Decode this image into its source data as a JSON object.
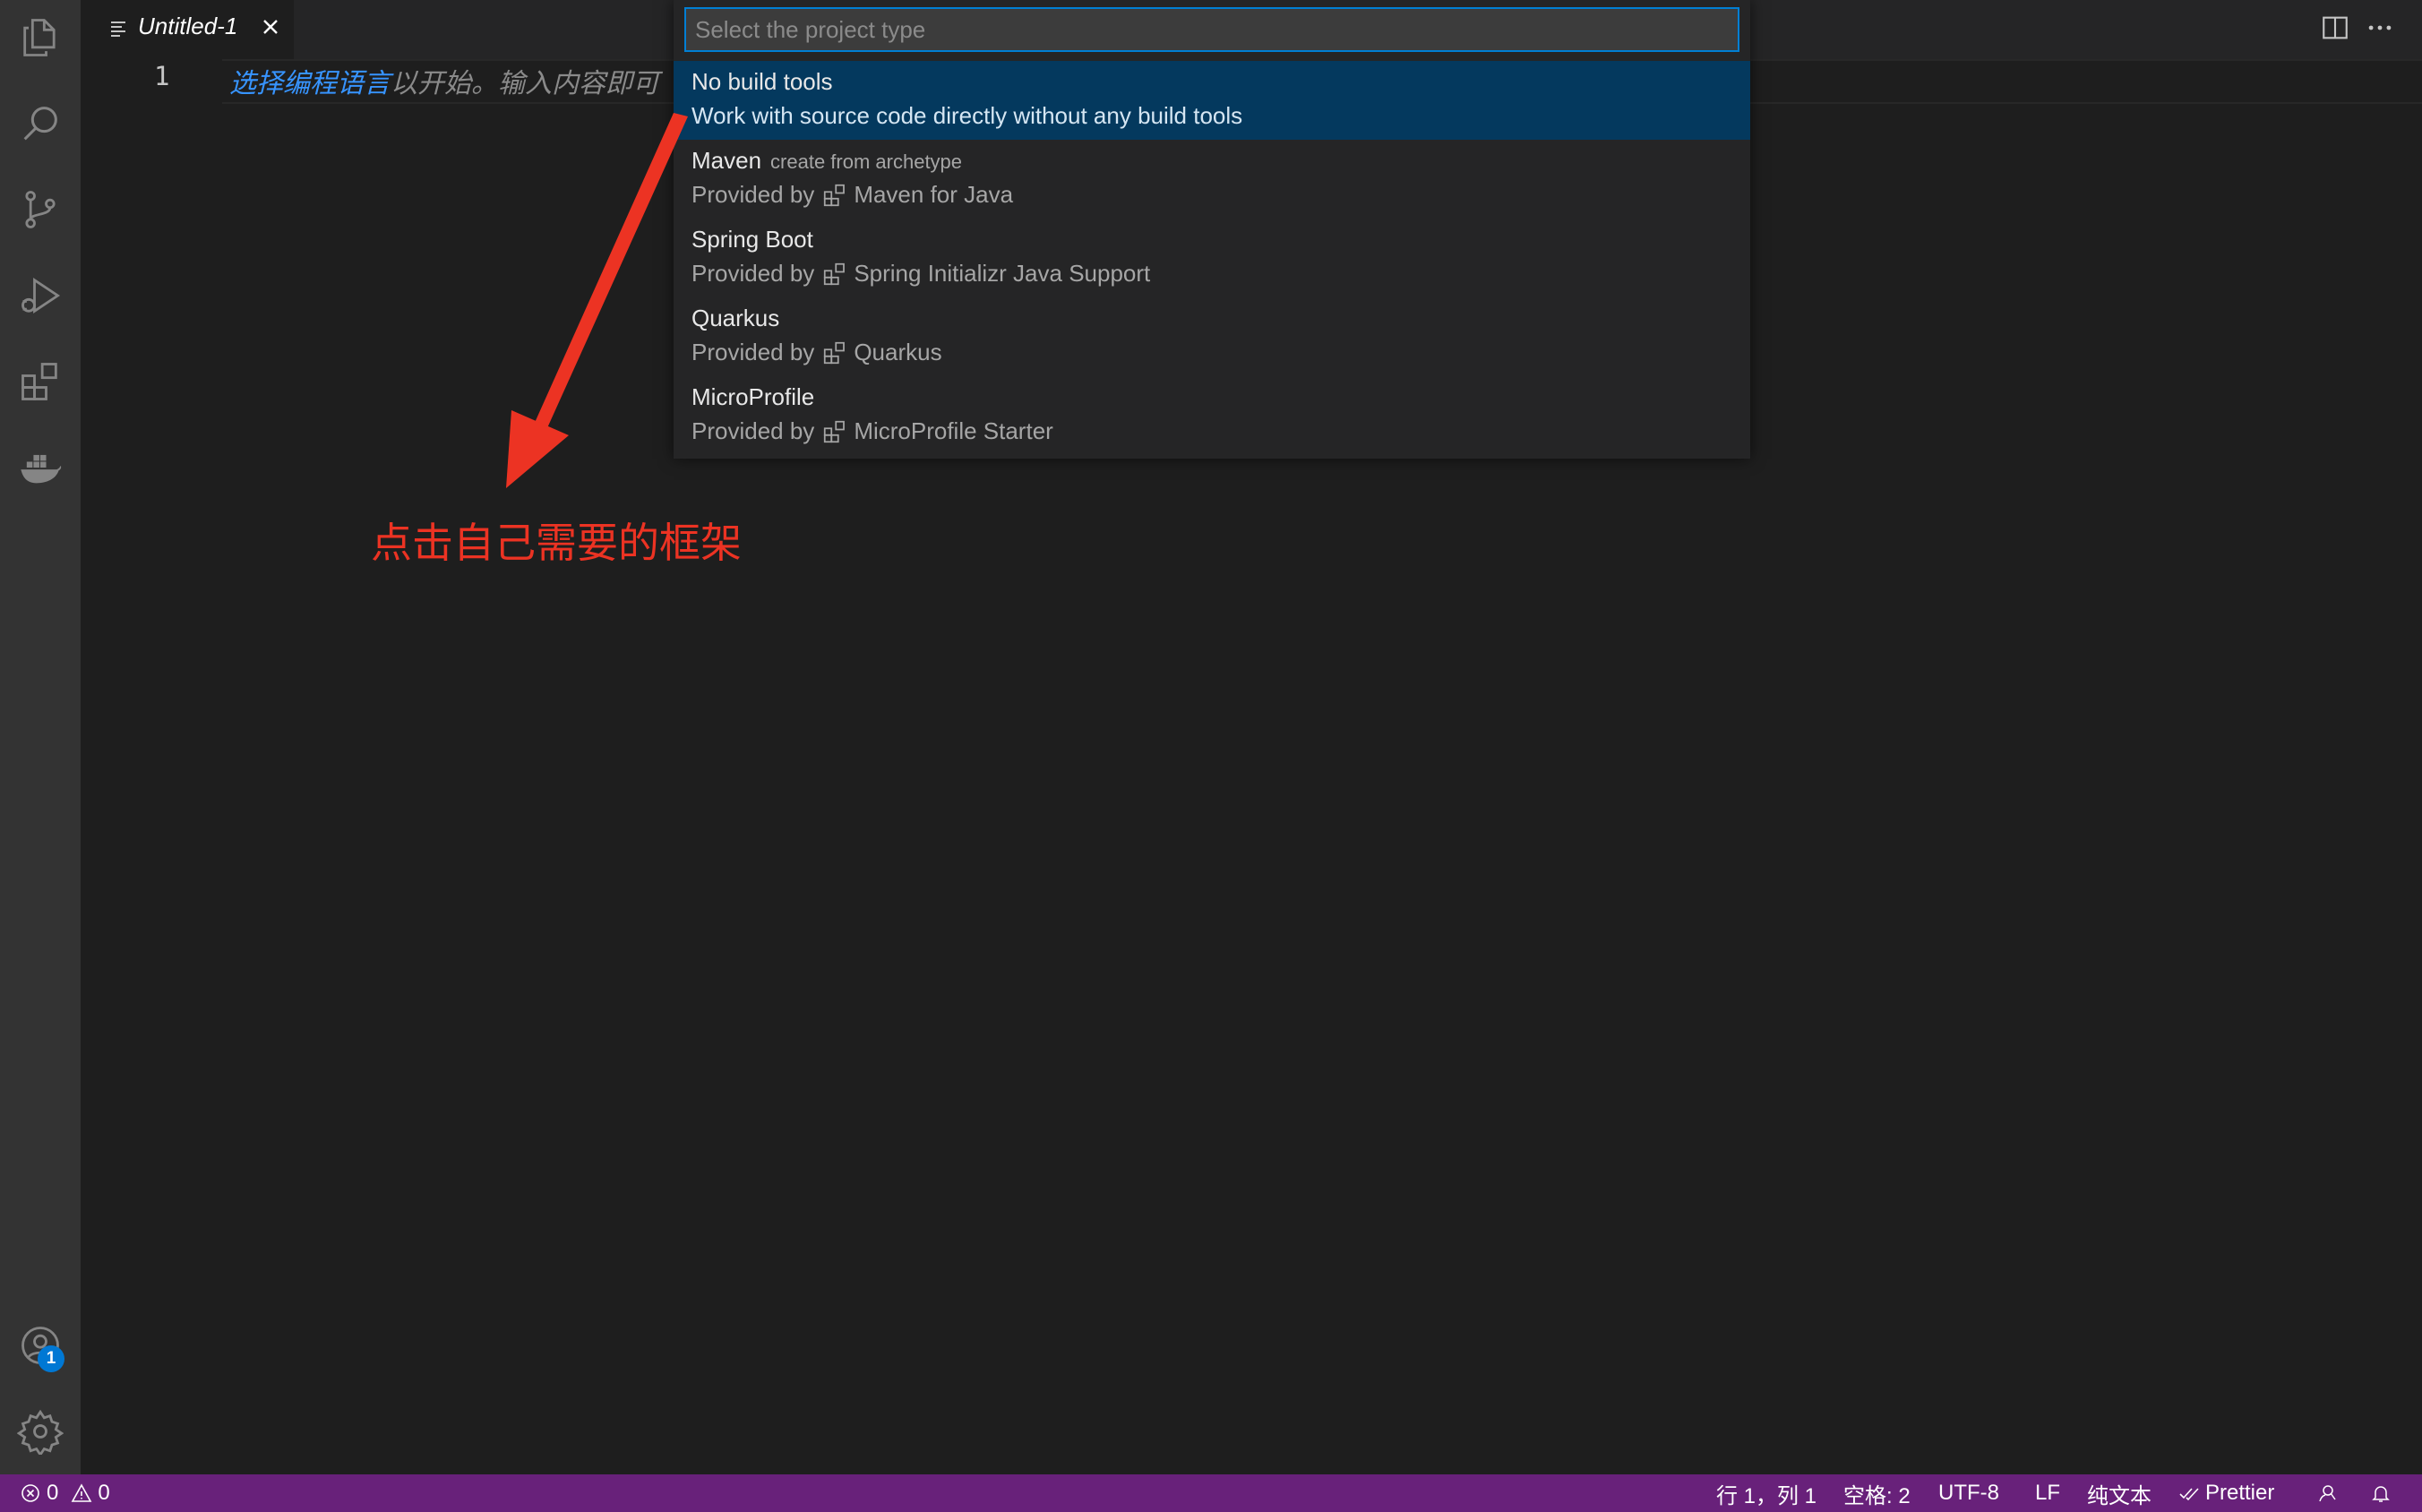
{
  "tab": {
    "title": "Untitled-1"
  },
  "editor": {
    "line_number": "1",
    "hint_link": "选择编程语言",
    "hint_text": "以开始。输入内容即可"
  },
  "quick_pick": {
    "placeholder": "Select the project type",
    "items": [
      {
        "label": "No build tools",
        "description": "",
        "detail": "Work with source code directly without any build tools"
      },
      {
        "label": "Maven",
        "description": "create from archetype",
        "detail_prefix": "Provided by",
        "extension": "Maven for Java"
      },
      {
        "label": "Spring Boot",
        "description": "",
        "detail_prefix": "Provided by",
        "extension": "Spring Initializr Java Support"
      },
      {
        "label": "Quarkus",
        "description": "",
        "detail_prefix": "Provided by",
        "extension": "Quarkus"
      },
      {
        "label": "MicroProfile",
        "description": "",
        "detail_prefix": "Provided by",
        "extension": "MicroProfile Starter"
      }
    ]
  },
  "annotation": {
    "text": "点击自己需要的框架",
    "color": "#ec3323"
  },
  "activity_bar": {
    "icons": [
      "files-icon",
      "search-icon",
      "source-control-icon",
      "run-debug-icon",
      "extensions-icon",
      "docker-icon",
      "account-icon",
      "settings-gear-icon"
    ],
    "account_badge": "1"
  },
  "status_bar": {
    "errors": "0",
    "warnings": "0",
    "position": "行 1，列 1",
    "spaces": "空格: 2",
    "encoding": "UTF-8",
    "eol": "LF",
    "language": "纯文本",
    "formatter": "Prettier",
    "color": "#68217a"
  },
  "colors": {
    "selection": "#04395e",
    "focus_border": "#007fd4",
    "link": "#3794ff"
  }
}
